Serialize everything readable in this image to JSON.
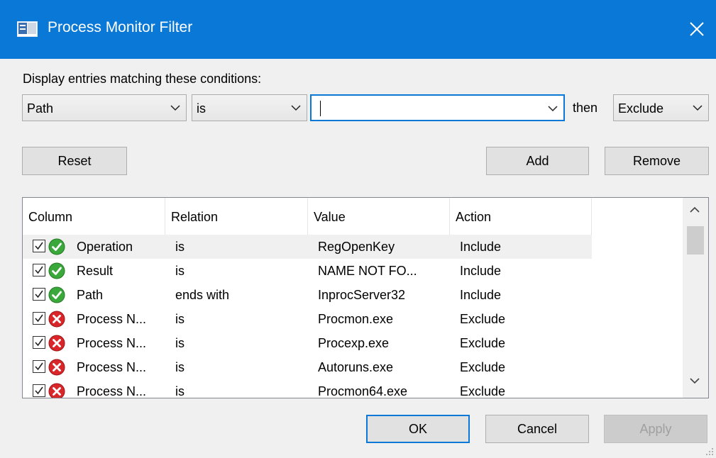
{
  "window": {
    "title": "Process Monitor Filter",
    "close_glyph": "✕",
    "accent_color": "#0a78d7"
  },
  "filter": {
    "conditions_label": "Display entries matching these conditions:",
    "column_value": "Path",
    "relation_value": "is",
    "value_text": "",
    "then_label": "then",
    "action_value": "Exclude"
  },
  "buttons": {
    "reset": "Reset",
    "add": "Add",
    "remove": "Remove",
    "ok": "OK",
    "cancel": "Cancel",
    "apply": "Apply"
  },
  "table": {
    "headers": [
      "Column",
      "Relation",
      "Value",
      "Action"
    ],
    "rows": [
      {
        "column": "Operation",
        "relation": "is",
        "value": "RegOpenKey",
        "action": "Include",
        "checked": true,
        "icon": "include-check-icon",
        "selected": true
      },
      {
        "column": "Result",
        "relation": "is",
        "value": "NAME NOT FO...",
        "action": "Include",
        "checked": true,
        "icon": "include-check-icon",
        "selected": false
      },
      {
        "column": "Path",
        "relation": "ends with",
        "value": "InprocServer32",
        "action": "Include",
        "checked": true,
        "icon": "include-check-icon",
        "selected": false
      },
      {
        "column": "Process N...",
        "relation": "is",
        "value": "Procmon.exe",
        "action": "Exclude",
        "checked": true,
        "icon": "exclude-x-icon",
        "selected": false
      },
      {
        "column": "Process N...",
        "relation": "is",
        "value": "Procexp.exe",
        "action": "Exclude",
        "checked": true,
        "icon": "exclude-x-icon",
        "selected": false
      },
      {
        "column": "Process N...",
        "relation": "is",
        "value": "Autoruns.exe",
        "action": "Exclude",
        "checked": true,
        "icon": "exclude-x-icon",
        "selected": false
      },
      {
        "column": "Process N...",
        "relation": "is",
        "value": "Procmon64.exe",
        "action": "Exclude",
        "checked": true,
        "icon": "exclude-x-icon",
        "selected": false
      }
    ]
  },
  "colors": {
    "include_icon": "#3aa83a",
    "exclude_icon": "#d8262a"
  }
}
